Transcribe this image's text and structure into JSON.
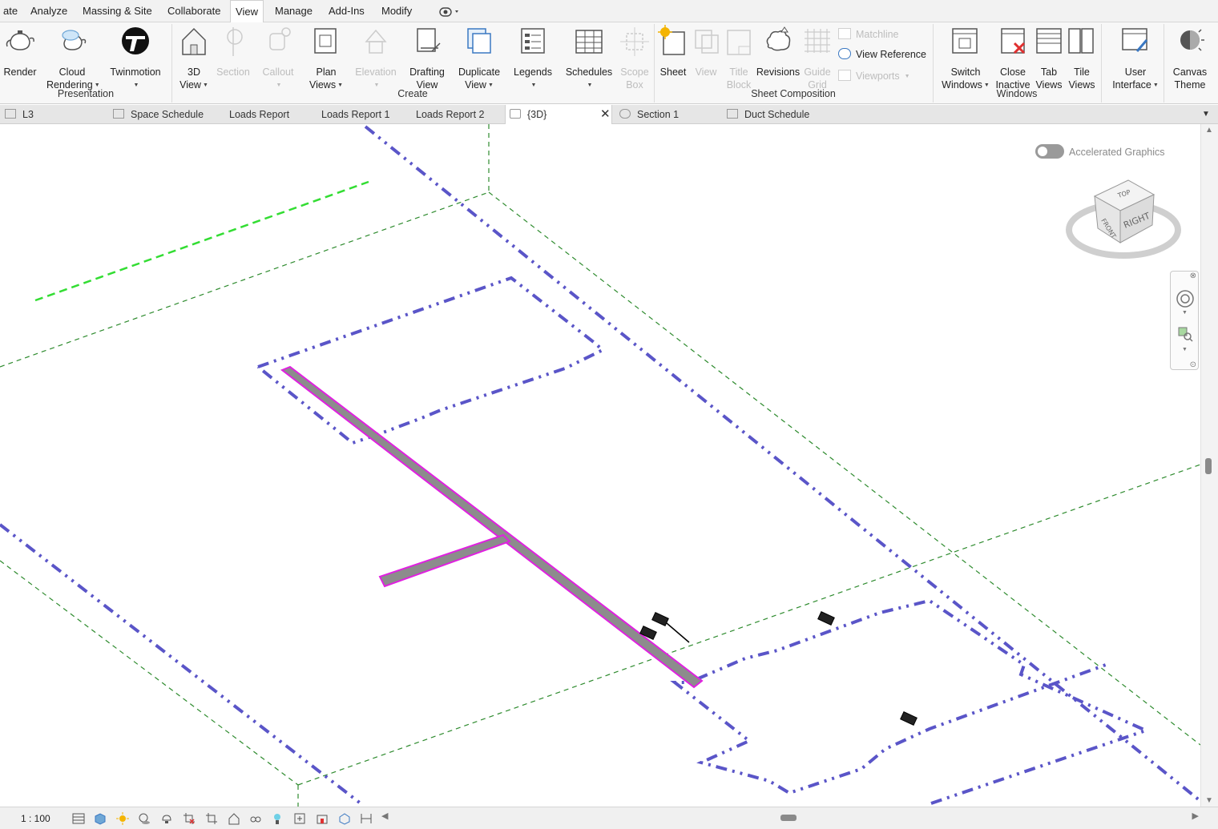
{
  "menu": {
    "tabs": [
      "ate",
      "Analyze",
      "Massing & Site",
      "Collaborate",
      "View",
      "Manage",
      "Add-Ins",
      "Modify"
    ],
    "active": "View"
  },
  "ribbon": {
    "presentation": {
      "title": "Presentation",
      "render": "Render",
      "cloud_rendering_1": "Cloud",
      "cloud_rendering_2": "Rendering",
      "twinmotion": "Twinmotion"
    },
    "create": {
      "title": "Create",
      "view3d_1": "3D",
      "view3d_2": "View",
      "section": "Section",
      "callout": "Callout",
      "plan_views_1": "Plan",
      "plan_views_2": "Views",
      "elevation": "Elevation",
      "drafting_1": "Drafting",
      "drafting_2": "View",
      "duplicate_1": "Duplicate",
      "duplicate_2": "View",
      "legends": "Legends",
      "schedules": "Schedules",
      "scope_box_1": "Scope",
      "scope_box_2": "Box"
    },
    "sheet_composition": {
      "title": "Sheet Composition",
      "sheet": "Sheet",
      "view": "View",
      "title_block_1": "Title",
      "title_block_2": "Block",
      "revisions": "Revisions",
      "guide_grid_1": "Guide",
      "guide_grid_2": "Grid",
      "matchline": "Matchline",
      "view_reference": "View  Reference",
      "viewports": "Viewports"
    },
    "windows": {
      "title": "Windows",
      "switch_1": "Switch",
      "switch_2": "Windows",
      "close_inactive_1": "Close",
      "close_inactive_2": "Inactive",
      "tab_views_1": "Tab",
      "tab_views_2": "Views",
      "tile_views_1": "Tile",
      "tile_views_2": "Views",
      "user_interface_1": "User",
      "user_interface_2": "Interface",
      "canvas_theme_1": "Canvas",
      "canvas_theme_2": "Theme"
    }
  },
  "view_tabs": {
    "l3": "L3",
    "space_schedule": "Space Schedule",
    "loads_report": "Loads Report",
    "loads_report_1": "Loads Report 1",
    "loads_report_2": "Loads Report 2",
    "view3d": "{3D}",
    "section1": "Section 1",
    "duct_schedule": "Duct Schedule"
  },
  "canvas": {
    "accelerated_graphics": "Accelerated Graphics",
    "viewcube": {
      "top": "TOP",
      "front": "FRONT",
      "right": "RIGHT"
    }
  },
  "status": {
    "scale": "1 : 100"
  },
  "colors": {
    "room_boundary": "#5a55c8",
    "grid_line": "#2e8b2e",
    "level_line": "#33dd33",
    "duct_fill": "#8c8c8c",
    "duct_highlight": "#e020e0"
  }
}
